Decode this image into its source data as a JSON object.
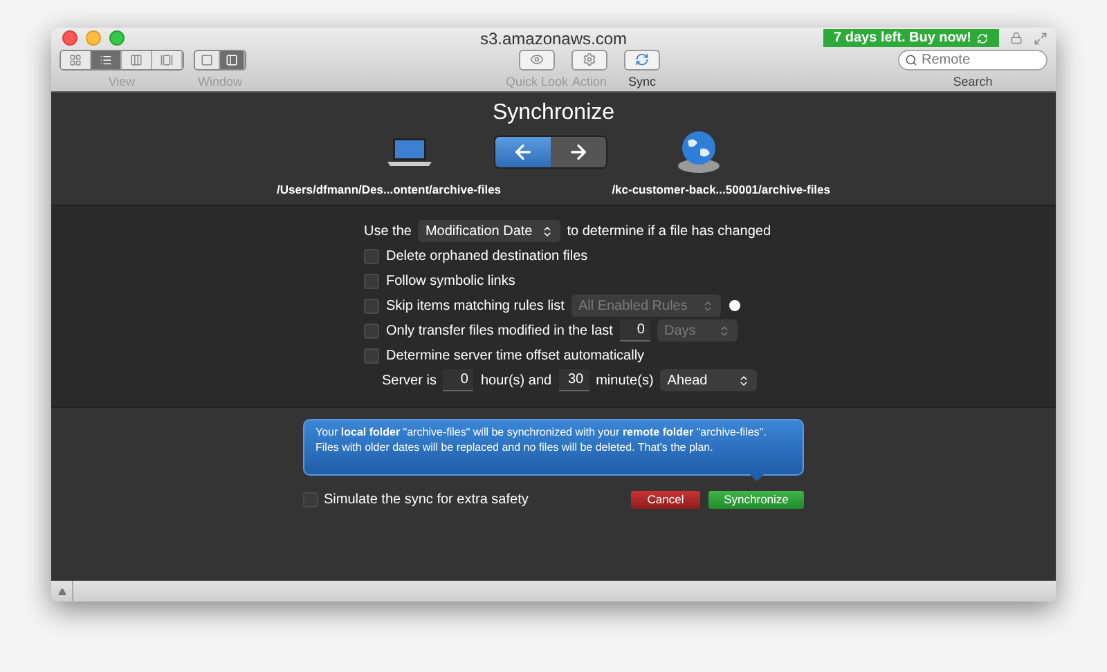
{
  "window": {
    "title": "s3.amazonaws.com"
  },
  "toolbar": {
    "view": {
      "label": "View",
      "segments": [
        {
          "selected": false
        },
        {
          "selected": true
        },
        {
          "selected": false
        },
        {
          "selected": false
        }
      ]
    },
    "window_mode": {
      "label": "Window",
      "segments": [
        {
          "selected": false
        },
        {
          "selected": true
        }
      ]
    },
    "buttons": [
      {
        "kind": "eye",
        "label": "Quick Look",
        "disabled": true
      },
      {
        "kind": "gear",
        "label": "Action",
        "disabled": true
      },
      {
        "kind": "sync",
        "label": "Sync",
        "disabled": false
      }
    ],
    "trial_badge": "7 days left. Buy now!",
    "search": {
      "placeholder": "Remote",
      "label": "Search"
    }
  },
  "sync": {
    "title": "Synchronize",
    "local_path": "/Users/dfmann/Des...ontent/archive-files",
    "remote_path": "/kc-customer-back...50001/archive-files",
    "direction": [
      {
        "selected": true
      },
      {
        "selected": false
      }
    ]
  },
  "options": [
    {
      "kind": "select",
      "before": "Use the",
      "value": "Modification Date",
      "after": "to determine if a file has changed"
    },
    {
      "kind": "checkbox",
      "label": "Delete orphaned destination files",
      "checked": false
    },
    {
      "kind": "checkbox",
      "label": "Follow symbolic links",
      "checked": false
    },
    {
      "kind": "rules",
      "label": "Skip items matching rules list",
      "checked": false,
      "select": {
        "value": "All Enabled Rules",
        "disabled": true
      }
    },
    {
      "kind": "modified",
      "label": "Only transfer files modified in the last",
      "checked": false,
      "number": "0",
      "select": {
        "value": "Days",
        "disabled": true
      }
    },
    {
      "kind": "checkbox",
      "label": "Determine server time offset automatically",
      "checked": false
    },
    {
      "kind": "offset",
      "label": "Server is",
      "hours": "0",
      "hours_label": "hour(s) and",
      "minutes": "30",
      "minutes_label": "minute(s)",
      "select": {
        "value": "Ahead",
        "disabled": false
      }
    }
  ],
  "message": [
    "Your **local folder** \"archive-files\" will be synchronized with your **remote folder** \"archive-files\".",
    "Files with older dates will be replaced and no files will be deleted. That's the plan."
  ],
  "simulate": {
    "label": "Simulate the sync for extra safety",
    "checked": false
  },
  "actions": [
    {
      "kind": "cancel",
      "label": "Cancel"
    },
    {
      "kind": "confirm",
      "label": "Synchronize"
    }
  ]
}
